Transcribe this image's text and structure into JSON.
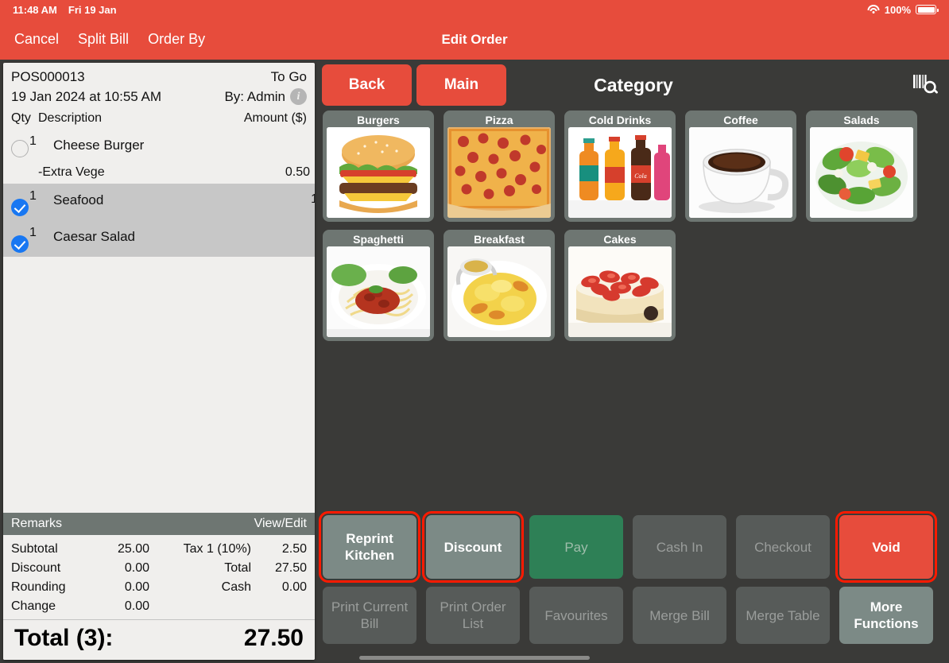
{
  "statusbar": {
    "time": "11:48 AM",
    "date": "Fri 19 Jan",
    "battery_percent": "100%",
    "wifi_icon": "wifi-icon",
    "battery_icon": "battery-icon"
  },
  "navbar": {
    "cancel": "Cancel",
    "split_bill": "Split Bill",
    "order_by": "Order By",
    "title": "Edit Order"
  },
  "order": {
    "id": "POS000013",
    "type": "To Go",
    "datetime": "19 Jan 2024 at 10:55 AM",
    "by": "By: Admin",
    "info_icon": "info-icon",
    "columns": {
      "qty": "Qty",
      "description": "Description",
      "amount": "Amount ($)"
    },
    "items": [
      {
        "checked": false,
        "qty": "1",
        "description": "Cheese Burger",
        "amount": "",
        "modifier": false,
        "selected": false
      },
      {
        "checked": null,
        "qty": "",
        "description": "-Extra Vege",
        "amount": "0.50",
        "modifier": true,
        "selected": false
      },
      {
        "checked": true,
        "qty": "1",
        "description": "Seafood",
        "amount": "1",
        "modifier": false,
        "selected": true
      },
      {
        "checked": true,
        "qty": "1",
        "description": "Caesar Salad",
        "amount": "",
        "modifier": false,
        "selected": true
      }
    ],
    "remarks_label": "Remarks",
    "remarks_action": "View/Edit",
    "totals": [
      {
        "left_label": "Subtotal",
        "left_value": "25.00",
        "right_label": "Tax 1 (10%)",
        "right_value": "2.50"
      },
      {
        "left_label": "Discount",
        "left_value": "0.00",
        "right_label": "Total",
        "right_value": "27.50"
      },
      {
        "left_label": "Rounding",
        "left_value": "0.00",
        "right_label": "Cash",
        "right_value": "0.00"
      },
      {
        "left_label": "Change",
        "left_value": "0.00",
        "right_label": "",
        "right_value": ""
      }
    ],
    "grand_label": "Total (3):",
    "grand_value": "27.50"
  },
  "content": {
    "back": "Back",
    "main": "Main",
    "title": "Category",
    "scan_icon": "barcode-scan-icon",
    "categories": [
      {
        "label": "Burgers",
        "image": "burger"
      },
      {
        "label": "Pizza",
        "image": "pizza"
      },
      {
        "label": "Cold Drinks",
        "image": "bottles"
      },
      {
        "label": "Coffee",
        "image": "coffee"
      },
      {
        "label": "Salads",
        "image": "salad"
      },
      {
        "label": "Spaghetti",
        "image": "spaghetti"
      },
      {
        "label": "Breakfast",
        "image": "breakfast"
      },
      {
        "label": "Cakes",
        "image": "cake"
      }
    ]
  },
  "actions": {
    "row1": [
      {
        "label": "Reprint Kitchen",
        "state": "enabled",
        "highlight": true
      },
      {
        "label": "Discount",
        "state": "enabled",
        "highlight": true
      },
      {
        "label": "Pay",
        "state": "pay",
        "highlight": false
      },
      {
        "label": "Cash In",
        "state": "disabled",
        "highlight": false
      },
      {
        "label": "Checkout",
        "state": "disabled",
        "highlight": false
      },
      {
        "label": "Void",
        "state": "void",
        "highlight": true
      }
    ],
    "row2": [
      {
        "label": "Print Current Bill",
        "state": "disabled",
        "highlight": false
      },
      {
        "label": "Print Order List",
        "state": "disabled",
        "highlight": false
      },
      {
        "label": "Favourites",
        "state": "disabled",
        "highlight": false
      },
      {
        "label": "Merge Bill",
        "state": "disabled",
        "highlight": false
      },
      {
        "label": "Merge Table",
        "state": "disabled",
        "highlight": false
      },
      {
        "label": "More Functions",
        "state": "enabled",
        "highlight": false
      }
    ]
  },
  "colors": {
    "accent_red": "#e74c3c",
    "pay_green": "#2e8056",
    "highlight": "#ff1a00",
    "panel_bg": "#f0efed",
    "tile_gray": "#6e7672",
    "app_bg": "#3a3a38"
  }
}
